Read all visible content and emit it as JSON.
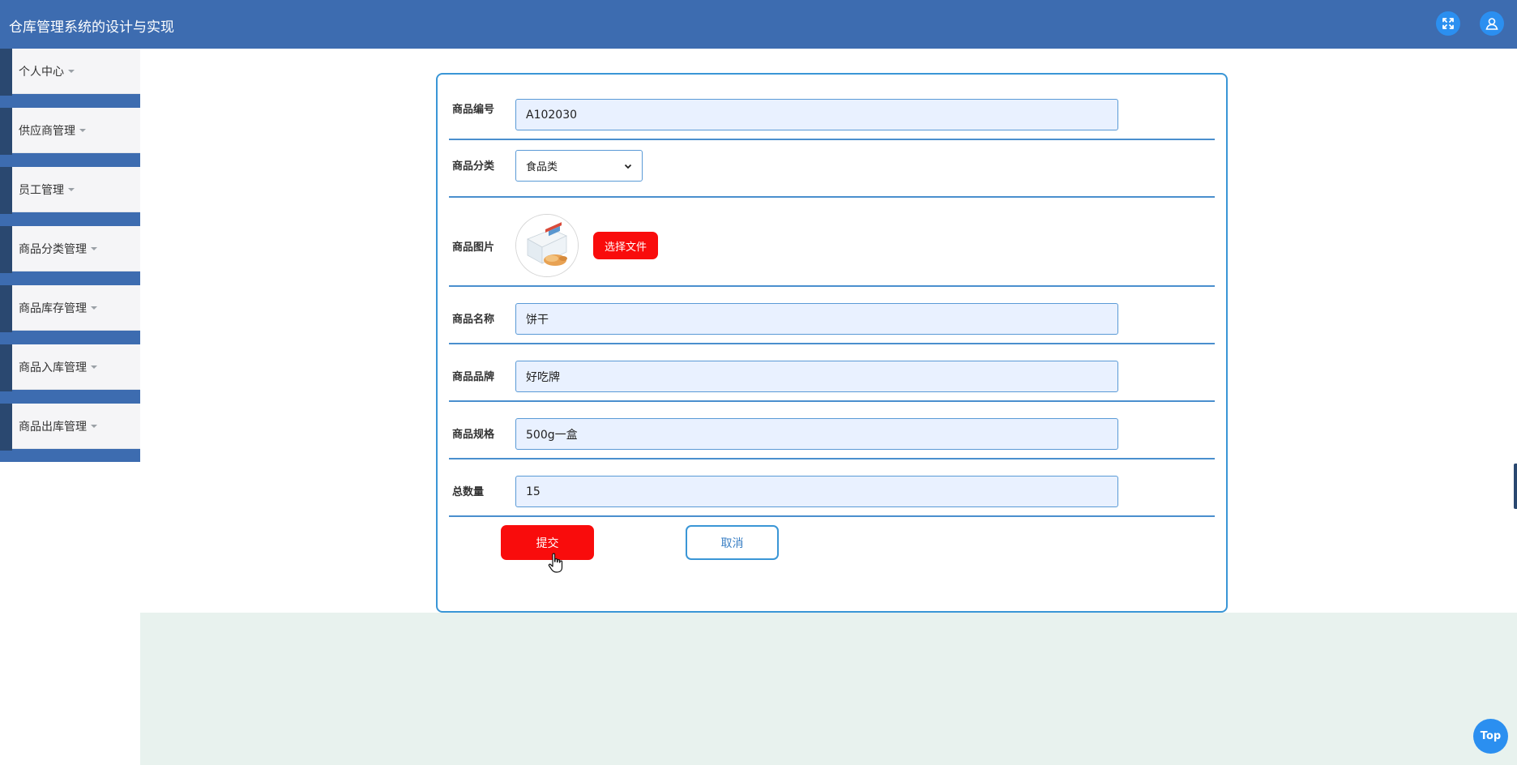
{
  "header": {
    "title": "仓库管理系统的设计与实现",
    "fullscreen_icon": "fullscreen-icon",
    "user_icon": "user-icon"
  },
  "sidebar": {
    "items": [
      {
        "label": "个人中心"
      },
      {
        "label": "供应商管理"
      },
      {
        "label": "员工管理"
      },
      {
        "label": "商品分类管理"
      },
      {
        "label": "商品库存管理"
      },
      {
        "label": "商品入库管理"
      },
      {
        "label": "商品出库管理"
      }
    ]
  },
  "form": {
    "code": {
      "label": "商品编号",
      "value": "A102030"
    },
    "category": {
      "label": "商品分类",
      "value": "食品类"
    },
    "image": {
      "label": "商品图片",
      "button": "选择文件"
    },
    "name": {
      "label": "商品名称",
      "value": "饼干"
    },
    "brand": {
      "label": "商品品牌",
      "value": "好吃牌"
    },
    "spec": {
      "label": "商品规格",
      "value": "500g一盒"
    },
    "total": {
      "label": "总数量",
      "value": "15"
    },
    "submit": "提交",
    "cancel": "取消"
  },
  "top_button": "Top",
  "colors": {
    "header": "#3d6cb0",
    "accent_red": "#f90c0c",
    "border_blue": "#3a96d6",
    "input_bg": "#e9f1ff",
    "top_button": "#2b8ff0"
  }
}
